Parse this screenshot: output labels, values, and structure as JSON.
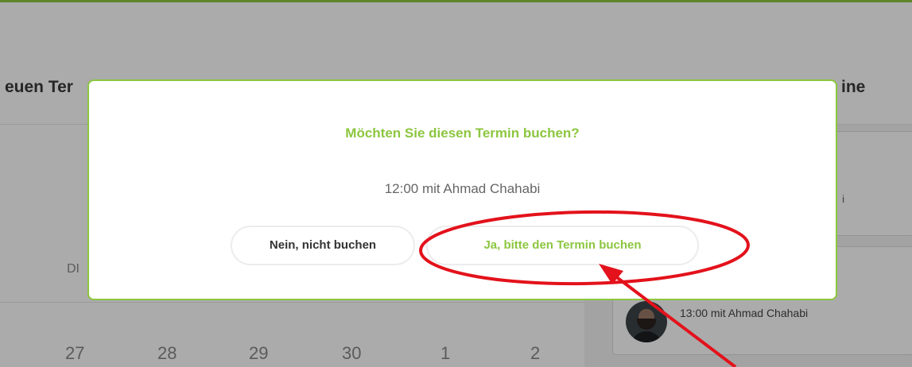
{
  "background": {
    "heading_left": "euen Ter",
    "heading_right": "ine",
    "card1_text": "i",
    "weekday_label": "DI",
    "appointment": "13:00 mit Ahmad Chahabi",
    "days": [
      "27",
      "28",
      "29",
      "30",
      "1",
      "2"
    ]
  },
  "dialog": {
    "title": "Möchten Sie diesen Termin buchen?",
    "subtitle": "12:00 mit Ahmad Chahabi",
    "cancel_label": "Nein, nicht buchen",
    "confirm_label": "Ja, bitte den Termin buchen"
  },
  "colors": {
    "accent": "#8cc63f",
    "annotation": "#e3121b"
  },
  "icons": {
    "avatar": "user-avatar-photo"
  }
}
